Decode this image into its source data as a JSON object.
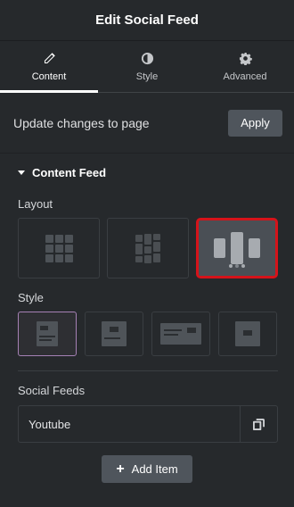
{
  "header": {
    "title": "Edit Social Feed"
  },
  "tabs": [
    {
      "label": "Content",
      "icon": "pencil-icon",
      "active": true
    },
    {
      "label": "Style",
      "icon": "contrast-icon",
      "active": false
    },
    {
      "label": "Advanced",
      "icon": "gear-icon",
      "active": false
    }
  ],
  "update": {
    "label": "Update changes to page",
    "apply_label": "Apply"
  },
  "section": {
    "title": "Content Feed"
  },
  "layout": {
    "label": "Layout",
    "options": [
      "grid",
      "masonry",
      "carousel"
    ],
    "selected": "carousel",
    "selected_color": "#d5131a"
  },
  "style": {
    "label": "Style",
    "options": [
      "style-1",
      "style-2",
      "style-3",
      "style-4"
    ],
    "selected": "style-1"
  },
  "social_feeds": {
    "label": "Social Feeds",
    "items": [
      {
        "title": "Youtube"
      }
    ],
    "add_label": "Add Item"
  }
}
